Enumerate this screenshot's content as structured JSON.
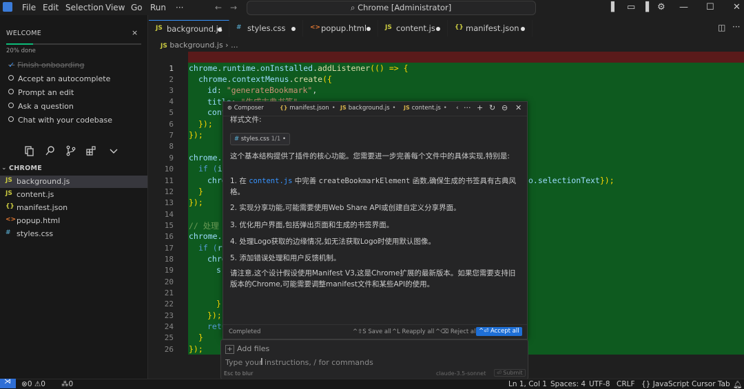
{
  "menu": [
    "File",
    "Edit",
    "Selection",
    "View",
    "Go",
    "Run",
    "···"
  ],
  "command_center": "Chrome [Administrator]",
  "welcome": {
    "title": "WELCOME",
    "progress_text": "20% done",
    "progress_percent": 20,
    "items": [
      {
        "label": "Finish onboarding",
        "done": true
      },
      {
        "label": "Accept an autocomplete",
        "done": false
      },
      {
        "label": "Prompt an edit",
        "done": false
      },
      {
        "label": "Ask a question",
        "done": false
      },
      {
        "label": "Chat with your codebase",
        "done": false
      }
    ]
  },
  "explorer": {
    "title": "CHROME",
    "files": [
      {
        "icon": "JS",
        "name": "background.js",
        "color": "#cbcb41",
        "active": true
      },
      {
        "icon": "JS",
        "name": "content.js",
        "color": "#cbcb41",
        "active": false
      },
      {
        "icon": "{}",
        "name": "manifest.json",
        "color": "#cbcb41",
        "active": false
      },
      {
        "icon": "<>",
        "name": "popup.html",
        "color": "#e37933",
        "active": false
      },
      {
        "icon": "#",
        "name": "styles.css",
        "color": "#519aba",
        "active": false
      }
    ]
  },
  "tabs": [
    {
      "icon": "JS",
      "label": "background.js",
      "color": "#cbcb41"
    },
    {
      "icon": "#",
      "label": "styles.css",
      "color": "#519aba"
    },
    {
      "icon": "<>",
      "label": "popup.html",
      "color": "#e37933"
    },
    {
      "icon": "JS",
      "label": "content.js",
      "color": "#cbcb41"
    },
    {
      "icon": "{}",
      "label": "manifest.json",
      "color": "#cbcb41"
    }
  ],
  "breadcrumb": {
    "icon": "JS",
    "file": "background.js",
    "rest": "..."
  },
  "line_numbers": [
    "1",
    "2",
    "3",
    "4",
    "5",
    "6",
    "7",
    "8",
    "9",
    "10",
    "11",
    "12",
    "13",
    "14",
    "15",
    "16",
    "17",
    "18",
    "19",
    "20",
    "21",
    "22",
    "23",
    "24",
    "25",
    "26"
  ],
  "code": {
    "l1": [
      "chrome",
      ".",
      "runtime",
      ".",
      "onInstalled",
      ".",
      "addListener",
      "(() => {"
    ],
    "l2": [
      "chrome",
      ".",
      "contextMenus",
      ".",
      "create",
      "({"
    ],
    "l3": [
      "id",
      ": ",
      "\"generateBookmark\"",
      ","
    ],
    "l4": [
      "title",
      ": ",
      "\"生成古典书签\""
    ],
    "l5": [
      "cont"
    ],
    "l6": "});",
    "l7": "});",
    "l9": "chrome.",
    "l10a": "if (",
    "l10b": "i",
    "l11a": "chro",
    "l11b": "o.selectionText",
    "l11c": "});",
    "l12": "}",
    "l13": "});",
    "l15": "// 处理",
    "l16": "chrome.",
    "l17a": "if (",
    "l17b": "r",
    "l18": "chro",
    "l19": "s",
    "l22": "}",
    "l23": "});",
    "l24": "retu",
    "l25": "}",
    "l26": "});"
  },
  "composer": {
    "tabs": [
      {
        "label": "Composer",
        "icon": "⊙"
      },
      {
        "label": "manifest.json",
        "icon": "{}"
      },
      {
        "label": "background.js",
        "icon": "JS"
      },
      {
        "label": "content.js",
        "icon": "JS"
      }
    ],
    "heading": "样式文件:",
    "chip_file": "styles.css",
    "chip_count": "1/1",
    "intro": "这个基本结构提供了插件的核心功能。您需要进一步完善每个文件中的具体实现,特别是:",
    "p1a": "1. 在 ",
    "p1_code": "content.js",
    "p1b": " 中完善 ",
    "p1_fn": "createBookmarkElement",
    "p1c": " 函数,确保生成的书签具有古典风格。",
    "p2": "2. 实现分享功能,可能需要使用Web Share API或创建自定义分享界面。",
    "p3": "3. 优化用户界面,包括弹出页面和生成的书签界面。",
    "p4": "4. 处理Logo获取的边缘情况,如无法获取Logo时使用默认图像。",
    "p5": "5. 添加错误处理和用户反馈机制。",
    "note": "请注意,这个设计假设使用Manifest V3,这是Chrome扩展的最新版本。如果您需要支持旧版本的Chrome,可能需要调整manifest文件和某些API的使用。",
    "status": "Completed",
    "save_all": "^⇧S Save all",
    "reapply_all": "^L Reapply all",
    "reject_all": "^⌫ Reject all",
    "accept_all": "^⏎ Accept all"
  },
  "input": {
    "add_files": "Add files",
    "placeholder": "Type your instructions, / for commands",
    "esc_hint": "Esc to blur",
    "model": "claude-3.5-sonnet",
    "submit": "⏎ Submit"
  },
  "status": {
    "errors": "0",
    "warnings": "0",
    "ports": "0",
    "position": "Ln 1, Col 1",
    "spaces": "Spaces: 4",
    "encoding": "UTF-8",
    "eol": "CRLF",
    "language": "JavaScript",
    "cursor_tab": "Cursor Tab"
  }
}
